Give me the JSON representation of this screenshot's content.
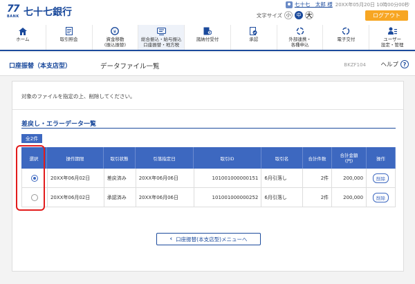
{
  "header": {
    "logo_number": "77",
    "logo_bank": "BANK",
    "bank_name": "七十七銀行",
    "user_name": "七十七　太郎 様",
    "login_time": "20XX年05月20日 10時00分00秒",
    "font_size_label": "文字サイズ",
    "font_small": "小",
    "font_medium": "中",
    "font_large": "大",
    "logout_label": "ログアウト"
  },
  "nav": {
    "items": [
      {
        "label": "ホーム",
        "icon": "home-icon"
      },
      {
        "label": "取引照会",
        "icon": "document-list-icon"
      },
      {
        "label": "資金移動\n(振込振替)",
        "icon": "money-transfer-icon"
      },
      {
        "label": "総合振込・給与振込\n口座振替・地方税",
        "icon": "batch-transfer-icon"
      },
      {
        "label": "諸納付受付",
        "icon": "payment-icon"
      },
      {
        "label": "承認",
        "icon": "approval-icon"
      },
      {
        "label": "外部連携・\n各種申込",
        "icon": "link-icon"
      },
      {
        "label": "電子交付",
        "icon": "electronic-delivery-icon"
      },
      {
        "label": "ユーザー\n設定・管理",
        "icon": "user-settings-icon"
      }
    ]
  },
  "title_bar": {
    "section": "口座振替（本支店型）",
    "title": "データファイル一覧",
    "screen_id": "BKZF104",
    "help_label": "ヘルプ",
    "help_icon": "?"
  },
  "main": {
    "instruction": "対象のファイルを指定の上、削除してください。",
    "section_title": "差戻し・エラーデータ一覧",
    "count_badge": "全2件",
    "table": {
      "headers": [
        "選択",
        "操作期限",
        "取引状態",
        "引落指定日",
        "取引ID",
        "取引名",
        "合計件数",
        "合計金額\n(円)",
        "操作"
      ],
      "rows": [
        {
          "selected": true,
          "deadline": "20XX年06月02日",
          "status": "差戻済み",
          "date": "20XX年06月06日",
          "id": "101001000000151",
          "name": "6月引落し",
          "count": "2件",
          "amount": "200,000",
          "action": "削除"
        },
        {
          "selected": false,
          "deadline": "20XX年06月02日",
          "status": "承認済み",
          "date": "20XX年06月06日",
          "id": "101001000000252",
          "name": "6月引落し",
          "count": "2件",
          "amount": "200,000",
          "action": "削除"
        }
      ]
    },
    "back_button": "口座振替(本支店型)メニューへ"
  },
  "colors": {
    "primary": "#1b4a9c",
    "table_header": "#3d68c0",
    "logout": "#f7a623",
    "highlight": "#e21b1b"
  }
}
